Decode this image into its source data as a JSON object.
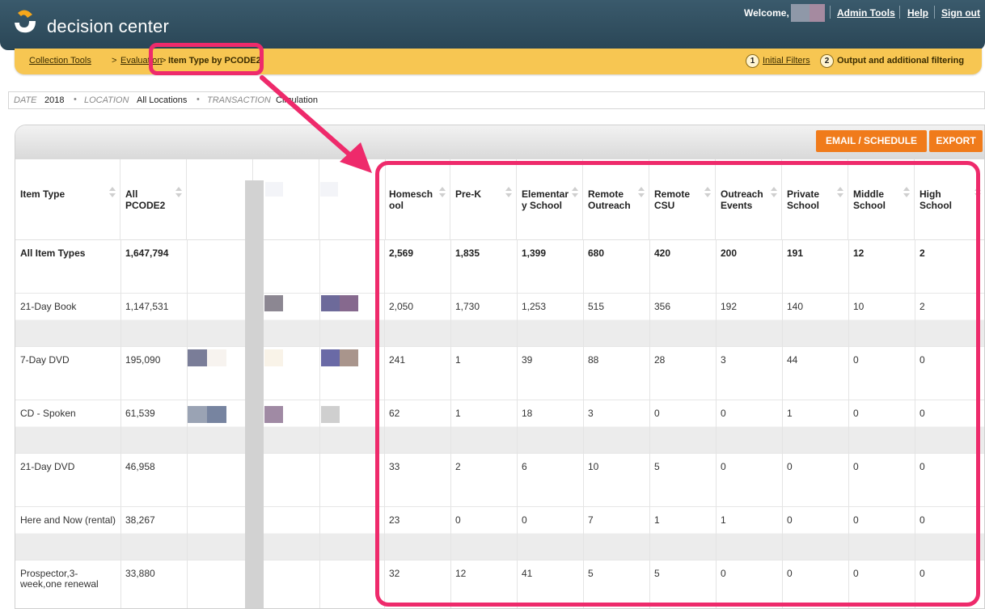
{
  "header": {
    "brand": "decision center",
    "welcome": "Welcome,",
    "links": [
      "Admin Tools",
      "Help",
      "Sign out"
    ]
  },
  "breadcrumb": {
    "items": [
      "Collection Tools",
      ">",
      "Evaluation",
      ">",
      "Item Type by PCODE2"
    ],
    "steps": [
      {
        "num": "1",
        "label": "Initial Filters"
      },
      {
        "num": "2",
        "label": "Output and additional filtering"
      }
    ]
  },
  "filters": {
    "date_key": "DATE",
    "date_val": "2018",
    "location_key": "LOCATION",
    "location_val": "All Locations",
    "transaction_key": "TRANSACTION",
    "transaction_val": "Circulation",
    "dot": "•"
  },
  "actions": {
    "email": "EMAIL / SCHEDULE",
    "export": "EXPORT"
  },
  "table": {
    "headers": [
      "Item Type",
      "All PCODE2",
      "",
      "",
      "",
      "",
      "Homesch ool",
      "Pre-K",
      "Elementar y School",
      "Remote Outreach",
      "Remote CSU",
      "Outreach Events",
      "Private School",
      "Middle School",
      "High School"
    ],
    "rows": [
      [
        "All Item Types",
        "1,647,794",
        "2,569",
        "1,835",
        "1,399",
        "680",
        "420",
        "200",
        "191",
        "12",
        "2"
      ],
      [
        "21-Day Book",
        "1,147,531",
        "2,050",
        "1,730",
        "1,253",
        "515",
        "356",
        "192",
        "140",
        "10",
        "2"
      ],
      [
        "7-Day DVD",
        "195,090",
        "241",
        "1",
        "39",
        "88",
        "28",
        "3",
        "44",
        "0",
        "0"
      ],
      [
        "CD - Spoken",
        "61,539",
        "62",
        "1",
        "18",
        "3",
        "0",
        "0",
        "1",
        "0",
        "0"
      ],
      [
        "21-Day DVD",
        "46,958",
        "33",
        "2",
        "6",
        "10",
        "5",
        "0",
        "0",
        "0",
        "0"
      ],
      [
        "Here and Now (rental)",
        "38,267",
        "23",
        "0",
        "0",
        "7",
        "1",
        "1",
        "0",
        "0",
        "0"
      ],
      [
        "Prospector,3-week,one renewal",
        "33,880",
        "32",
        "12",
        "41",
        "5",
        "5",
        "0",
        "0",
        "0",
        "0"
      ]
    ]
  },
  "colors": {
    "highlight": "#ee2a6b",
    "orange": "#f07b1b",
    "crumbbar": "#f7c652",
    "header": "#2f4c5d"
  }
}
